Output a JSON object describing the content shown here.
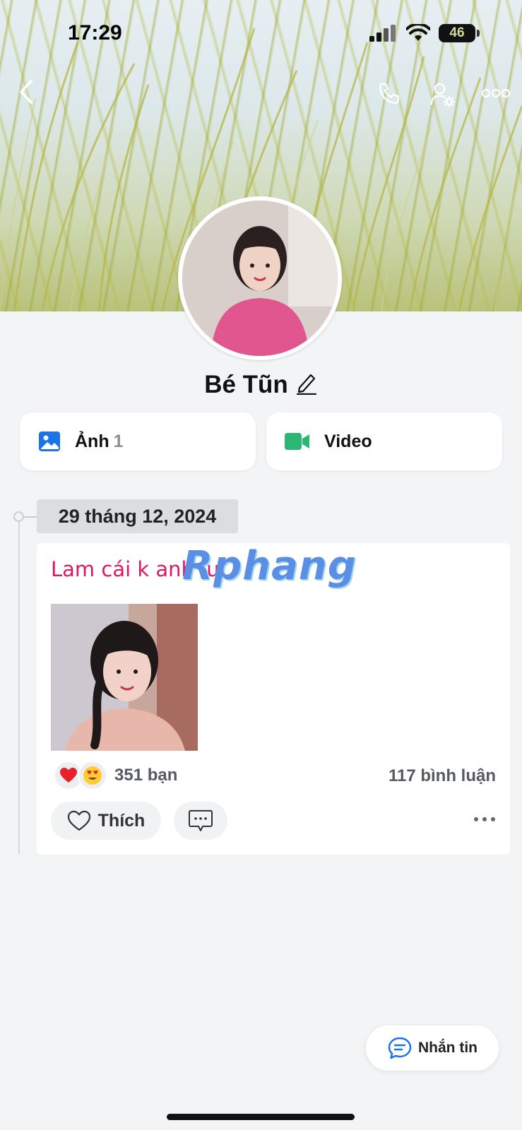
{
  "status_bar": {
    "time": "17:29",
    "battery": "46"
  },
  "profile": {
    "name": "Bé Tũn"
  },
  "media": {
    "photos_label": "Ảnh",
    "photos_count": "1",
    "video_label": "Video"
  },
  "timeline": {
    "date": "29 tháng 12, 2024"
  },
  "post": {
    "text": "Lam cái k anh iu",
    "watermark": "Rphang",
    "reactions": [
      "heart-emoji",
      "heart-eyes-emoji"
    ],
    "reaction_count": "351 bạn",
    "comment_count": "117 bình luận",
    "like_label": "Thích"
  },
  "message_button": {
    "label": "Nhắn tin"
  },
  "colors": {
    "background": "#f3f4f6",
    "post_text": "#e0185f",
    "photo_icon": "#1a73e8",
    "video_icon": "#2bb673",
    "message_icon": "#1a73e8"
  }
}
